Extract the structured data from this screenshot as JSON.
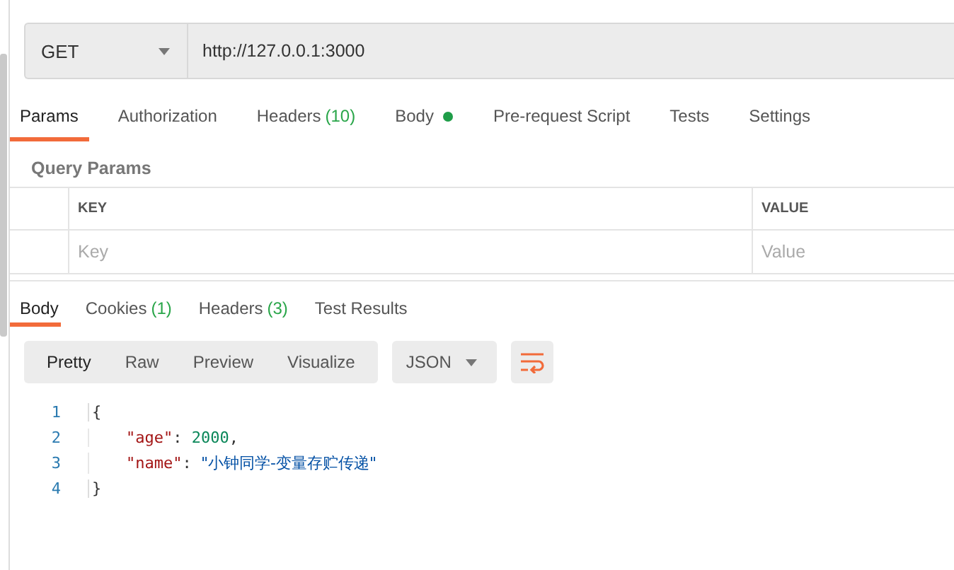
{
  "request": {
    "method": "GET",
    "url": "http://127.0.0.1:3000"
  },
  "request_tabs": [
    {
      "label": "Params",
      "selected": true
    },
    {
      "label": "Authorization",
      "selected": false
    },
    {
      "label": "Headers",
      "count": "(10)",
      "selected": false
    },
    {
      "label": "Body",
      "dot": true,
      "selected": false
    },
    {
      "label": "Pre-request Script",
      "selected": false
    },
    {
      "label": "Tests",
      "selected": false
    },
    {
      "label": "Settings",
      "selected": false
    }
  ],
  "query_params": {
    "title": "Query Params",
    "columns": [
      "KEY",
      "VALUE"
    ],
    "placeholders": [
      "Key",
      "Value"
    ]
  },
  "response_tabs": [
    {
      "label": "Body",
      "selected": true
    },
    {
      "label": "Cookies",
      "count": "(1)",
      "selected": false
    },
    {
      "label": "Headers",
      "count": "(3)",
      "selected": false
    },
    {
      "label": "Test Results",
      "selected": false
    }
  ],
  "view_modes": [
    {
      "label": "Pretty",
      "selected": true
    },
    {
      "label": "Raw",
      "selected": false
    },
    {
      "label": "Preview",
      "selected": false
    },
    {
      "label": "Visualize",
      "selected": false
    }
  ],
  "format": "JSON",
  "code_lines": [
    {
      "number": "1",
      "indented": false,
      "tokens": [
        {
          "kind": "punct",
          "text": "{"
        }
      ]
    },
    {
      "number": "2",
      "indented": true,
      "tokens": [
        {
          "kind": "key",
          "text": "\"age\""
        },
        {
          "kind": "punct",
          "text": ": "
        },
        {
          "kind": "number",
          "text": "2000"
        },
        {
          "kind": "punct",
          "text": ","
        }
      ]
    },
    {
      "number": "3",
      "indented": true,
      "tokens": [
        {
          "kind": "key",
          "text": "\"name\""
        },
        {
          "kind": "punct",
          "text": ": "
        },
        {
          "kind": "string",
          "text": "\"小钟同学-变量存贮传递\""
        }
      ]
    },
    {
      "number": "4",
      "indented": false,
      "tokens": [
        {
          "kind": "punct",
          "text": "}"
        }
      ]
    }
  ]
}
